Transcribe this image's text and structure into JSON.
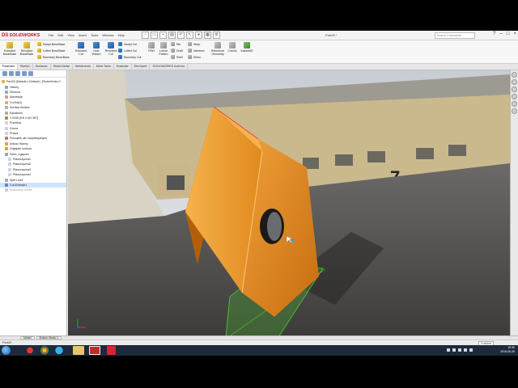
{
  "app": {
    "logo_ds": "DS",
    "logo_text": "SOLIDWORKS",
    "document_title": "Part29 *",
    "search_placeholder": "Search Commands",
    "window_controls": [
      "?",
      "–",
      "□",
      "×"
    ]
  },
  "menu": [
    "File",
    "Edit",
    "View",
    "Insert",
    "Tools",
    "Window",
    "Help"
  ],
  "ribbon": {
    "big_buttons": [
      {
        "label": "Extruded Boss/Base",
        "icon": "extruded-boss-icon"
      },
      {
        "label": "Revolved Boss/Base",
        "icon": "revolved-boss-icon"
      },
      {
        "label": "Extruded Cut",
        "icon": "extruded-cut-icon"
      },
      {
        "label": "Hole Wizard",
        "icon": "hole-wizard-icon"
      },
      {
        "label": "Revolved Cut",
        "icon": "revolved-cut-icon"
      },
      {
        "label": "Fillet",
        "icon": "fillet-icon"
      },
      {
        "label": "Linear Pattern",
        "icon": "linear-pattern-icon"
      },
      {
        "label": "Reference Geometry",
        "icon": "reference-geometry-icon"
      },
      {
        "label": "Curves",
        "icon": "curves-icon"
      },
      {
        "label": "Instant3D",
        "icon": "instant3d-icon"
      }
    ],
    "small_buttons": [
      {
        "label": "Swept Boss/Base"
      },
      {
        "label": "Lofted Boss/Base"
      },
      {
        "label": "Boundary Boss/Base"
      },
      {
        "label": "Swept Cut"
      },
      {
        "label": "Lofted Cut"
      },
      {
        "label": "Boundary Cut"
      },
      {
        "label": "Rib"
      },
      {
        "label": "Draft"
      },
      {
        "label": "Shell"
      },
      {
        "label": "Wrap"
      },
      {
        "label": "Intersect"
      },
      {
        "label": "Mirror"
      }
    ]
  },
  "tabs": [
    "Features",
    "Sketch",
    "Surfaces",
    "Sheet Metal",
    "Weldments",
    "Mold Tools",
    "Evaluate",
    "DimXpert",
    "SOLIDWORKS Add-Ins"
  ],
  "feature_tree": [
    {
      "label": "Part29 (Default<<Default>_PhotoWorks D",
      "icon": "part-icon"
    },
    {
      "label": "History",
      "icon": "history-icon"
    },
    {
      "label": "Sensors",
      "icon": "sensor-icon"
    },
    {
      "label": "Adnotacje",
      "icon": "annotations-icon"
    },
    {
      "label": "Cut list(1)",
      "icon": "cutlist-icon"
    },
    {
      "label": "Surface Bodies",
      "icon": "surface-bodies-icon"
    },
    {
      "label": "Equations",
      "icon": "equations-icon"
    },
    {
      "label": "1.0445 (EN 4 AH 36T)",
      "icon": "material-icon"
    },
    {
      "label": "Przednia",
      "icon": "plane-icon"
    },
    {
      "label": "Górna",
      "icon": "plane-icon"
    },
    {
      "label": "Prawa",
      "icon": "plane-icon"
    },
    {
      "label": "Początek ukł. współrzędnych",
      "icon": "origin-icon"
    },
    {
      "label": "Arkusz blachy",
      "icon": "sheetmetal-icon"
    },
    {
      "label": "Odgięcie konturu",
      "icon": "edge-flange-icon"
    },
    {
      "label": "Szkic_Łgięcia1",
      "icon": "sketch-icon"
    },
    {
      "label": "Płaszczyzna1",
      "icon": "plane-icon"
    },
    {
      "label": "Płaszczyzna2",
      "icon": "plane-icon"
    },
    {
      "label": "Płaszczyzna3",
      "icon": "plane-icon"
    },
    {
      "label": "Płaszczyzna4",
      "icon": "plane-icon"
    },
    {
      "label": "Split Line1",
      "icon": "splitline-icon"
    },
    {
      "label": "Cut-Extrude1",
      "icon": "cut-extrude-icon"
    },
    {
      "label": "Rozłożony model",
      "icon": "flat-pattern-icon"
    }
  ],
  "bottom_tabs": [
    "Model",
    "Motion Study 1"
  ],
  "status": {
    "left": "Part29",
    "right": "Custom"
  },
  "tray": {
    "time": "15:30",
    "date": "2018-06-26"
  },
  "colors": {
    "accent": "#c8102e",
    "part": "#e08a1e",
    "sketch_plane": "#4cd12c",
    "selection": "#cfe3ff"
  }
}
